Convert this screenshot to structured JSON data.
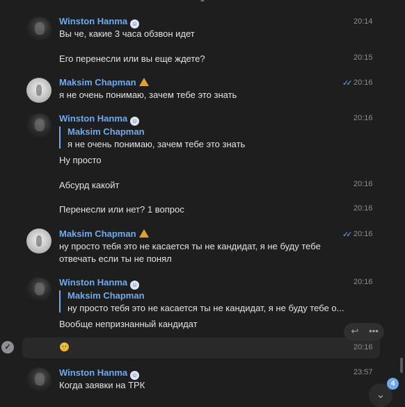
{
  "users": {
    "winston": "Winston Hanma",
    "maksim": "Maksim Chapman"
  },
  "messages": [
    {
      "text": "Вы че, какие 3 часа обзвон идет",
      "time": "20:14"
    },
    {
      "text": "Его перенесли или вы еще ждете?",
      "time": "20:15"
    },
    {
      "text": "я не очень понимаю, зачем тебе это знать",
      "time": "20:16"
    },
    {
      "reply_author": "Maksim Chapman",
      "reply_text": "я не очень понимаю, зачем тебе это знать",
      "text": "Ну просто",
      "time": "20:16"
    },
    {
      "text": "Абсурд какойт",
      "time": "20:16"
    },
    {
      "text": "Перенесли или нет? 1 вопрос",
      "time": "20:16"
    },
    {
      "text_line1": "ну просто тебя это не касается ты не кандидат, я не буду тебе",
      "text_line2": "отвечать если ты не понял",
      "time": "20:16"
    },
    {
      "reply_author": "Maksim Chapman",
      "reply_text": "ну просто тебя это не касается ты не кандидат, я не буду тебе о...",
      "text": "Вообще непризнанный кандидат",
      "time": "20:16"
    },
    {
      "emoji": "🥺",
      "time": "20:16"
    },
    {
      "text": "Когда заявки на ТРК",
      "time": "23:57"
    }
  ],
  "unread_count": "4",
  "icons": {
    "badge_winston": "cap-face-icon",
    "badge_maksim": "warning-triangle-icon",
    "read": "double-check-icon",
    "reply": "reply-icon",
    "more": "more-icon",
    "select": "check-circle-icon",
    "scroll_down": "chevron-down-icon"
  },
  "colors": {
    "background": "#1e1e1e",
    "accent": "#71aaeb",
    "text": "#e1e3e6",
    "muted": "#8c8f93"
  }
}
